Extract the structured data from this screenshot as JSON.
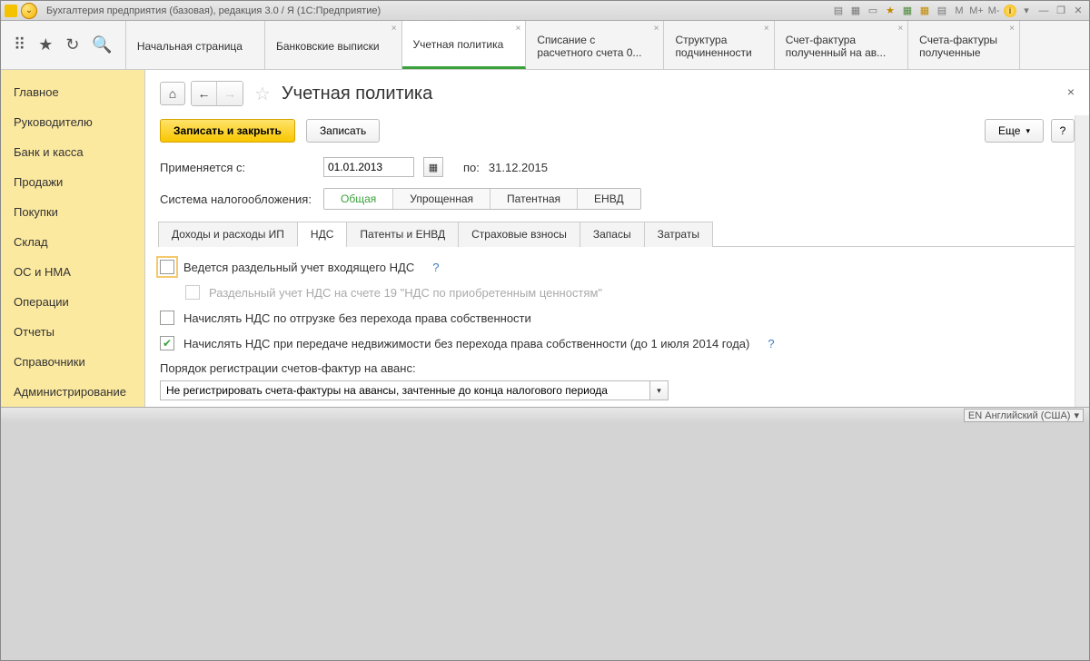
{
  "titlebar": {
    "title": "Бухгалтерия предприятия (базовая), редакция 3.0 / Я  (1С:Предприятие)"
  },
  "tabs": [
    {
      "label": "Начальная страница",
      "closable": false
    },
    {
      "label": "Банковские выписки",
      "closable": true
    },
    {
      "label": "Учетная политика",
      "closable": true,
      "active": true
    },
    {
      "label": "Списание с",
      "sub": "расчетного счета 0...",
      "closable": true
    },
    {
      "label": "Структура",
      "sub": "подчиненности",
      "closable": true
    },
    {
      "label": "Счет-фактура",
      "sub": "полученный на ав...",
      "closable": true
    },
    {
      "label": "Счета-фактуры",
      "sub": "полученные",
      "closable": true
    }
  ],
  "sidebar": {
    "items": [
      "Главное",
      "Руководителю",
      "Банк и касса",
      "Продажи",
      "Покупки",
      "Склад",
      "ОС и НМА",
      "Операции",
      "Отчеты",
      "Справочники",
      "Администрирование"
    ]
  },
  "page": {
    "title": "Учетная политика",
    "save_close": "Записать и закрыть",
    "save": "Записать",
    "more": "Еще",
    "help": "?",
    "applies_from_label": "Применяется с:",
    "applies_from": "01.01.2013",
    "to_label": "по:",
    "to_date": "31.12.2015",
    "tax_system_label": "Система налогообложения:",
    "tax_systems": [
      "Общая",
      "Упрощенная",
      "Патентная",
      "ЕНВД"
    ],
    "subtabs": [
      "Доходы и расходы ИП",
      "НДС",
      "Патенты и ЕНВД",
      "Страховые взносы",
      "Запасы",
      "Затраты"
    ],
    "check1": "Ведется раздельный учет входящего НДС",
    "check1sub": "Раздельный учет НДС на счете 19 \"НДС по приобретенным ценностям\"",
    "check2": "Начислять НДС по отгрузке без перехода права собственности",
    "check3": "Начислять НДС при передаче недвижимости без перехода права собственности (до 1 июля 2014 года)",
    "help_q": "?",
    "select_label": "Порядок регистрации счетов-фактур на аванс:",
    "select_value": "Не регистрировать счета-фактуры на авансы, зачтенные до конца налогового периода"
  },
  "statusbar": {
    "lang": "EN Английский (США)"
  }
}
